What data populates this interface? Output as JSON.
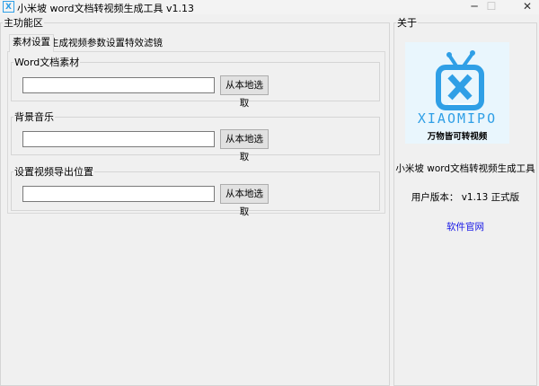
{
  "window": {
    "title": "小米坡 word文档转视频生成工具 v1.13",
    "icon": "x-tv-icon",
    "minimize": "─",
    "maximize": "☐",
    "close": "✕"
  },
  "main_group": {
    "label": "主功能区"
  },
  "tabs": [
    {
      "label": "素材设置",
      "active": true
    },
    {
      "label": "生成视频"
    },
    {
      "label": "参数设置"
    },
    {
      "label": "特效滤镜"
    }
  ],
  "sections": [
    {
      "label": "Word文档素材",
      "value": "",
      "button": "从本地选取"
    },
    {
      "label": "背景音乐",
      "value": "",
      "button": "从本地选取"
    },
    {
      "label": "设置视频导出位置",
      "value": "",
      "button": "从本地选取"
    }
  ],
  "about": {
    "label": "关于",
    "logo_text": "XIAOMIPO",
    "logo_slogan": "万物皆可转视频",
    "app_name": "小米坡 word文档转视频生成工具",
    "version": "用户版本： v1.13 正式版",
    "website": "软件官网"
  },
  "colors": {
    "accent": "#2f9fe6",
    "link": "#1a1ae6"
  }
}
